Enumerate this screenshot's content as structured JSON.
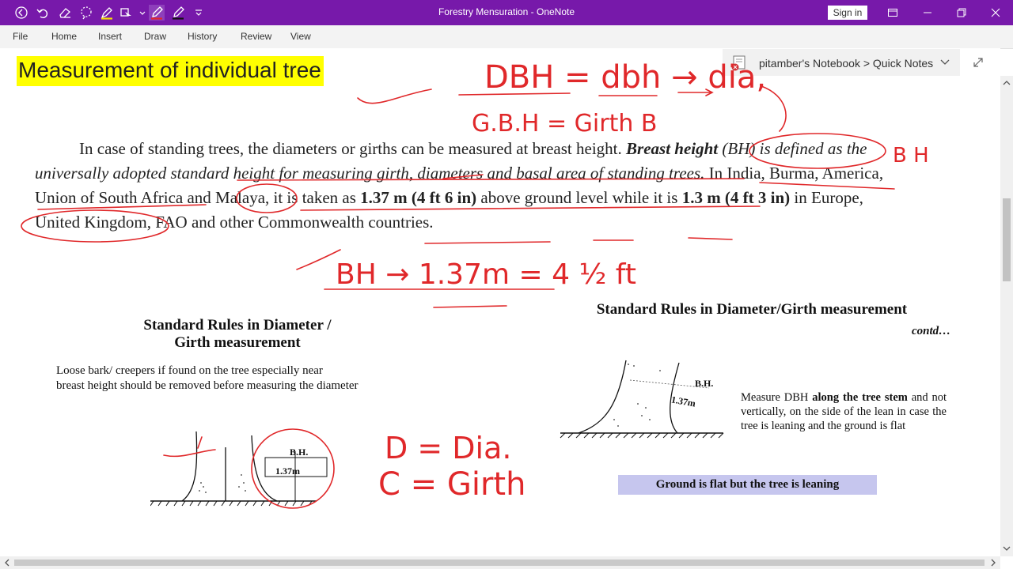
{
  "window": {
    "title": "Forestry Mensuration",
    "app_name": "OneNote",
    "title_full": "Forestry Mensuration - OneNote",
    "sign_in_label": "Sign in",
    "accent_color": "#7719aa"
  },
  "quick_access": {
    "icons": [
      "back-icon",
      "undo-icon",
      "eraser-icon",
      "lasso-select-icon",
      "lasso-dropdown-icon",
      "highlighter-icon",
      "pen-icon",
      "pen-black-icon",
      "customize-icon"
    ]
  },
  "menu": {
    "items": [
      "File",
      "Home",
      "Insert",
      "Draw",
      "History",
      "Review",
      "View"
    ]
  },
  "notebook": {
    "path": "pitamber's Notebook > Quick Notes"
  },
  "page": {
    "title": "Measurement of individual tree",
    "highlight_color": "#ffff00"
  },
  "paragraph": {
    "p1": "In case of standing trees, the diameters or girths can be measured at breast height.",
    "p2": "Breast height",
    "p3": "(BH) is defined as the universally adopted standard height for measuring girth, diameters and basal area of standing trees.",
    "p4": " In India, Burma, America, Union of South Africa and Malaya, it is taken as ",
    "p5": "1.37 m (4 ft 6 in)",
    "p6": " above ground level while it is ",
    "p7": "1.3 m (4 ft 3 in)",
    "p8": " in Europe, United Kingdom, FAO and other Commonwealth countries."
  },
  "slide_left": {
    "title_line1": "Standard Rules in Diameter /",
    "title_line2": "Girth measurement",
    "text_line1": "Loose bark/ creepers if found on the tree especially near",
    "text_line2": "breast height should be removed before measuring the diameter",
    "diagram_bh": "B.H.",
    "diagram_height": "1.37m"
  },
  "slide_right": {
    "title": "Standard Rules in Diameter/Girth measurement",
    "contd": "contd…",
    "diagram_bh": "B.H.",
    "diagram_height": "1.37m",
    "text_parts": {
      "a": "Measure DBH ",
      "b": "along the tree stem",
      "c": " and not vertically, on the side of the lean in case the tree is leaning and the ground is flat"
    },
    "caption": "Ground is flat but the tree is leaning",
    "caption_bg": "#c6c6ee"
  },
  "handwriting": {
    "color": "#e0282a",
    "notes": [
      "DBH = dbh → dia,",
      "G.B.H = Girth B",
      "B H",
      "BH → 1.37m = 4 ½ ft",
      "D = Dia.",
      "C = Girth"
    ]
  }
}
